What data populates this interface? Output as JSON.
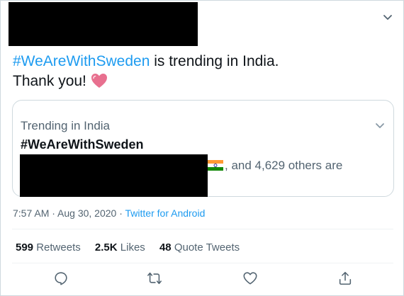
{
  "tweet": {
    "text": {
      "hashtag": "#WeAreWithSweden",
      "rest": " is trending in India.",
      "line2": "Thank you!"
    },
    "card": {
      "subtitle": "Trending in India",
      "title": "#WeAreWithSweden",
      "others": ", and 4,629 others are"
    },
    "meta": {
      "time": "7:57 AM · Aug 30, 2020 · ",
      "source": "Twitter for Android"
    },
    "stats": [
      {
        "num": "599",
        "label": "Retweets"
      },
      {
        "num": "2.5K",
        "label": "Likes"
      },
      {
        "num": "48",
        "label": "Quote Tweets"
      }
    ],
    "icons": {
      "reply": "reply-icon",
      "retweet": "retweet-icon",
      "like": "like-icon",
      "share": "share-icon",
      "more": "chevron-down-icon",
      "heart_emoji": "heart-emoji-icon",
      "flag": "india-flag-icon"
    },
    "colors": {
      "accent": "#1d9bf0",
      "muted": "#536471",
      "heart": "#e0245e"
    }
  }
}
